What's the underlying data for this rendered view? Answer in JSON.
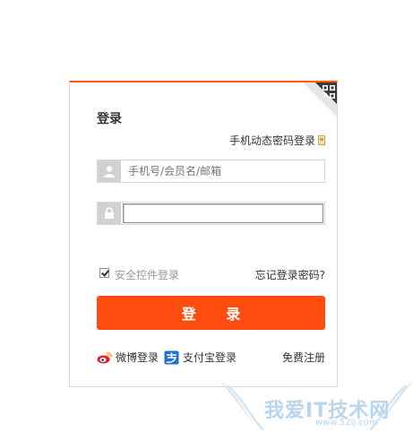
{
  "login": {
    "title": "登录",
    "sms_link": "手机动态密码登录",
    "username_placeholder": "手机号/会员名/邮箱",
    "password_value": "",
    "secure_control_label": "安全控件登录",
    "secure_control_checked": true,
    "forgot_link": "忘记登录密码?",
    "submit_label": "登 录",
    "accent_color": "#ff4d0f"
  },
  "footer": {
    "weibo_label": "微博登录",
    "alipay_label": "支付宝登录",
    "register_label": "免费注册"
  },
  "icons": {
    "qr": "qr-code-icon",
    "phone": "phone-icon",
    "user": "user-icon",
    "lock": "lock-icon",
    "weibo": "weibo-icon",
    "alipay": "alipay-icon"
  },
  "watermark": {
    "text": "我爱IT技术网",
    "url": "www.52ij.com"
  }
}
